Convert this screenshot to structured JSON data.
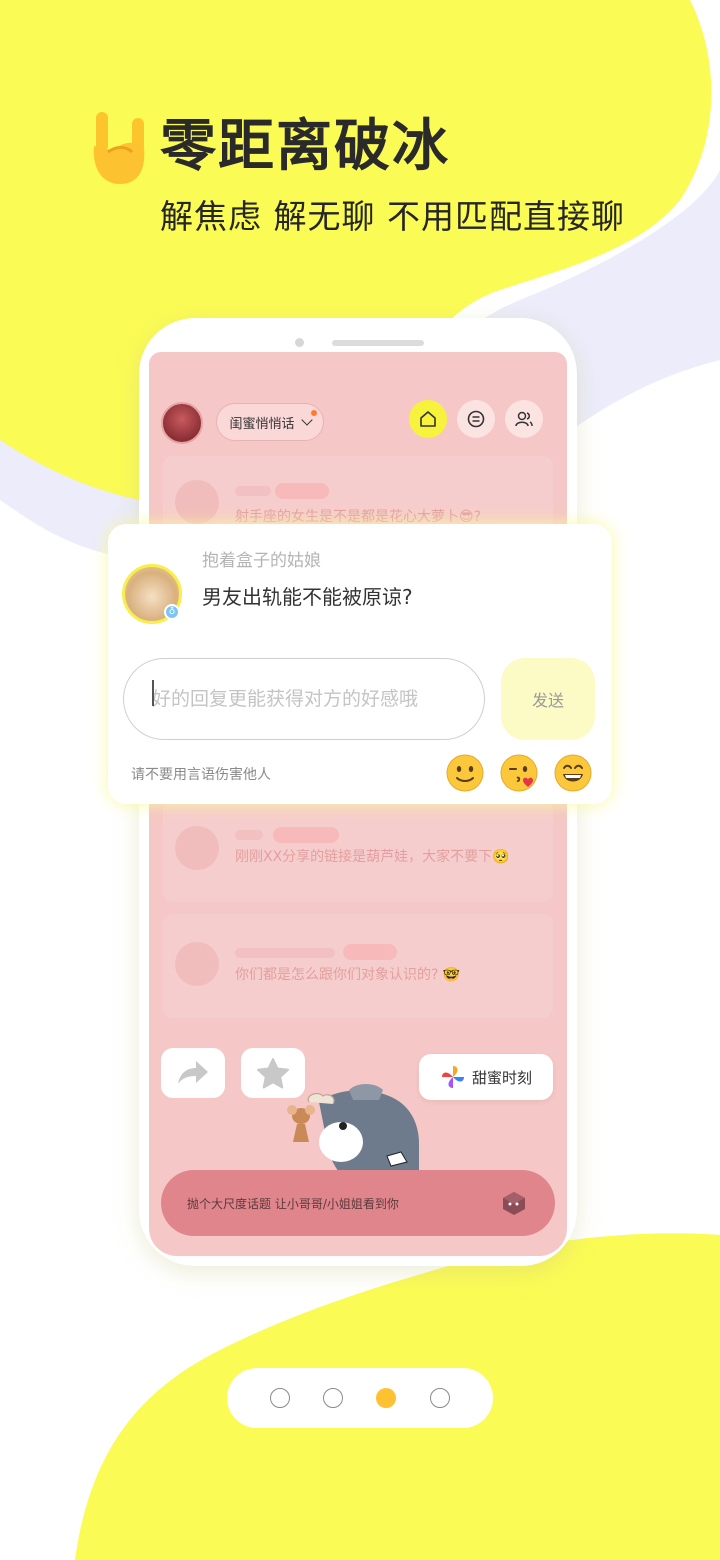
{
  "colors": {
    "yellow": "#fbfb55",
    "lavender": "#ececfb",
    "screen_pink": "#f5c7c6",
    "bottom_bar": "#e0858b",
    "pager_active": "#fdc131"
  },
  "hero": {
    "icon": "rock-hand-emoji-icon",
    "title": "零距离破冰",
    "subtitle": "解焦虑 解无聊 不用匹配直接聊"
  },
  "app": {
    "room_selector": {
      "label": "闺蜜悄悄话",
      "icon": "chevron-down-icon",
      "has_notification_dot": true
    },
    "nav_buttons": [
      {
        "name": "home",
        "icon": "home-icon",
        "active": true
      },
      {
        "name": "list",
        "icon": "list-icon",
        "active": false
      },
      {
        "name": "users",
        "icon": "users-icon",
        "active": false
      }
    ],
    "feed": [
      {
        "text": "射手座的女生是不是都是花心大萝卜😎?"
      },
      {
        "text": "刚刚XX分享的链接是葫芦娃，大家不要下🥺"
      },
      {
        "text": "你们都是怎么跟你们对象认识的? 🤓"
      }
    ],
    "actions": [
      {
        "name": "share",
        "icon": "share-arrow-icon"
      },
      {
        "name": "favorite",
        "icon": "star-icon"
      }
    ],
    "sweet_moment": {
      "label": "甜蜜时刻",
      "icon": "pinwheel-icon"
    },
    "bottom_bar": {
      "text": "抛个大尺度话题  让小哥哥/小姐姐看到你",
      "icon": "box-icon"
    }
  },
  "popup": {
    "user_name": "抱着盒子的姑娘",
    "question": "男友出轨能不能被原谅?",
    "gender_badge": "♁",
    "input_placeholder": "好的回复更能获得对方的好感哦",
    "send_label": "发送",
    "hint": "请不要用言语伤害他人",
    "emojis": [
      {
        "name": "slight-smile-emoji-icon"
      },
      {
        "name": "kiss-wink-emoji-icon"
      },
      {
        "name": "grin-emoji-icon"
      }
    ]
  },
  "pager": {
    "total": 4,
    "active_index": 2
  }
}
